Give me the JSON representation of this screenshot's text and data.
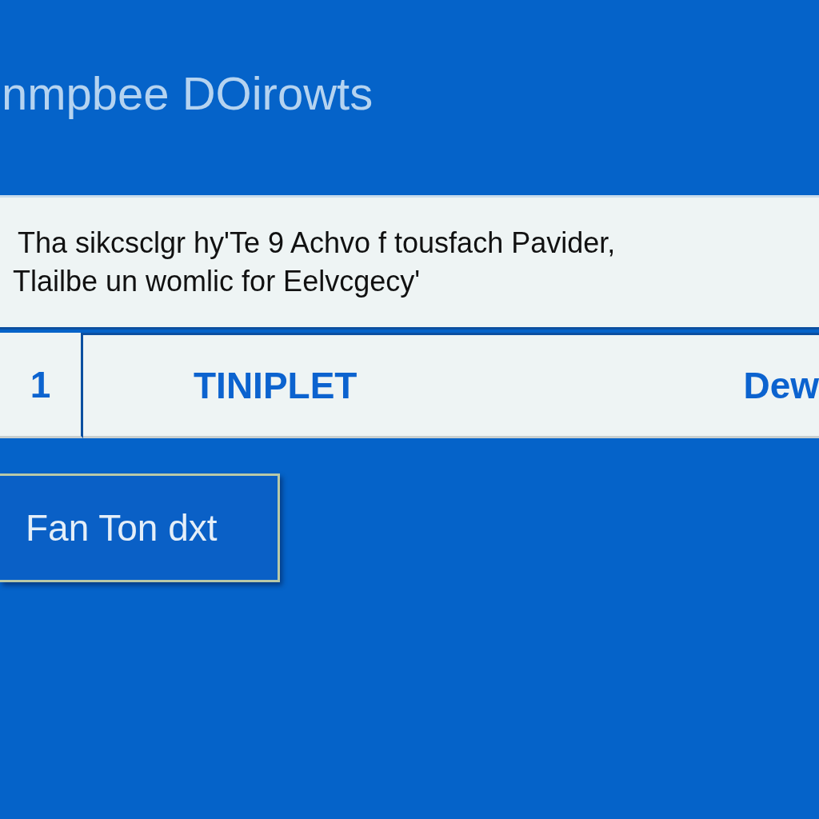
{
  "header": {
    "title": "nmpbee DOirowts"
  },
  "message": {
    "lines": [
      "Tha sikcsclgr hy'Te 9 Achvo f tousfach Pavider,",
      "Tlailbe un womlic for Eelvcgecy'"
    ]
  },
  "row": {
    "number": "1",
    "name": "TINIPLET",
    "column_3": "Dew"
  },
  "button": {
    "label": "Fan Ton dxt"
  }
}
